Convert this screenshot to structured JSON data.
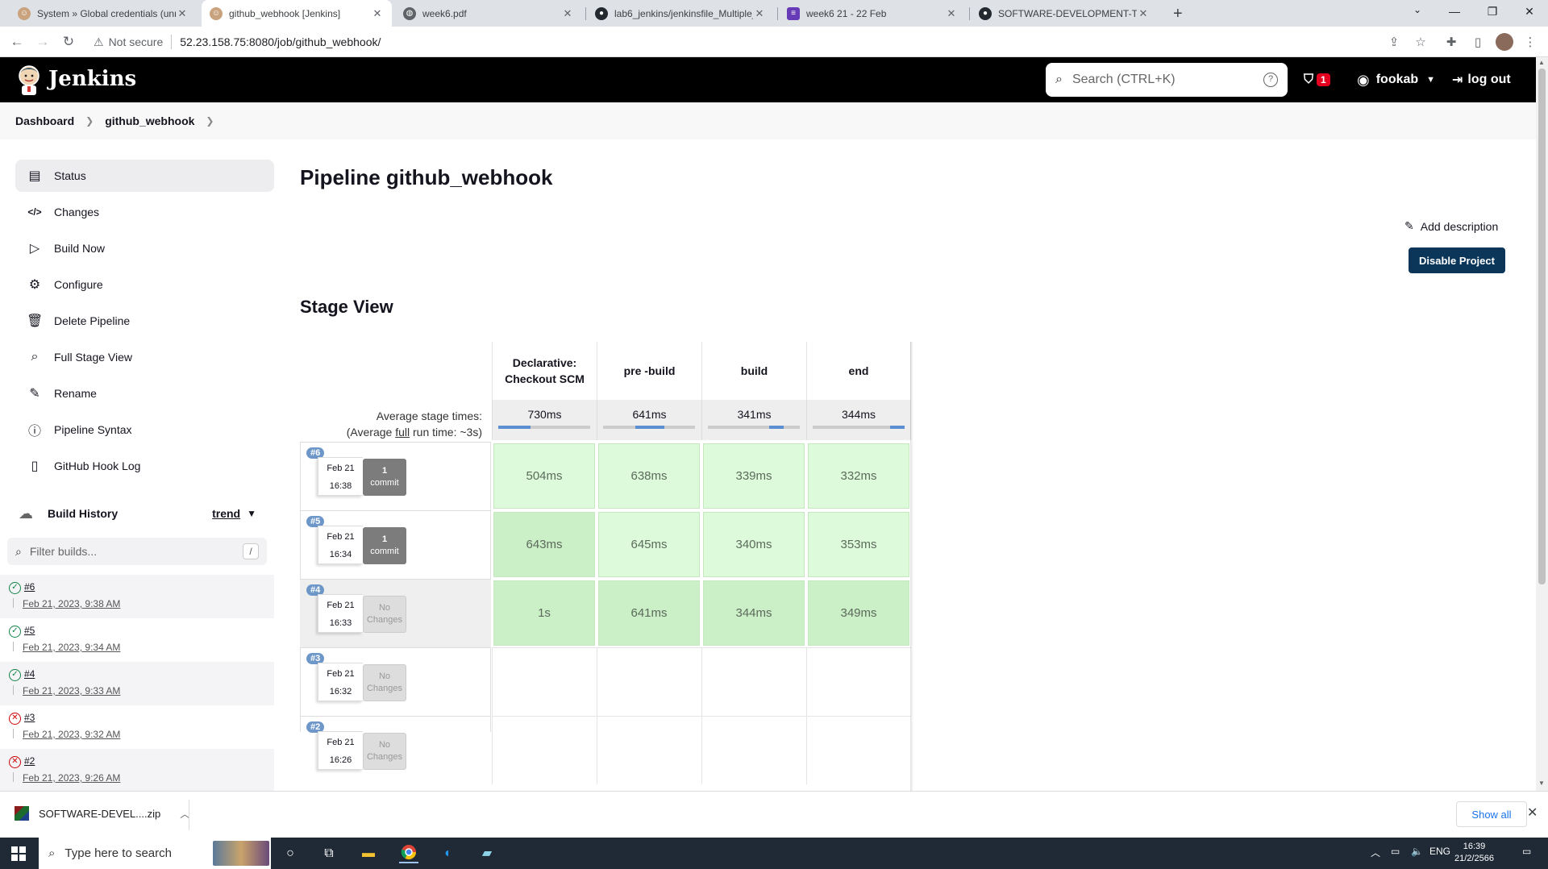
{
  "browser": {
    "tabs": [
      {
        "title": "System » Global credentials (unre",
        "icon": "jenkins-icon",
        "active": false
      },
      {
        "title": "github_webhook [Jenkins]",
        "icon": "jenkins-icon",
        "active": true
      },
      {
        "title": "week6.pdf",
        "icon": "globe-icon",
        "active": false
      },
      {
        "title": "lab6_jenkins/jenkinsfile_Multiple_",
        "icon": "github-icon",
        "active": false
      },
      {
        "title": "week6 21 - 22 Feb",
        "icon": "form-icon",
        "active": false
      },
      {
        "title": "SOFTWARE-DEVELOPMENT-TOO",
        "icon": "github-icon",
        "active": false
      }
    ],
    "security_label": "Not secure",
    "url": "52.23.158.75:8080/job/github_webhook/"
  },
  "header": {
    "brand": "Jenkins",
    "search_placeholder": "Search (CTRL+K)",
    "security_count": "1",
    "user": "fookab",
    "logout": "log out"
  },
  "breadcrumb": [
    "Dashboard",
    "github_webhook"
  ],
  "sidebar": {
    "items": [
      {
        "label": "Status",
        "icon": "notepad-icon",
        "glyph": "▤",
        "active": true
      },
      {
        "label": "Changes",
        "icon": "code-icon",
        "glyph": "</>",
        "active": false
      },
      {
        "label": "Build Now",
        "icon": "play-icon",
        "glyph": "▷",
        "active": false
      },
      {
        "label": "Configure",
        "icon": "gear-icon",
        "glyph": "⚙",
        "active": false
      },
      {
        "label": "Delete Pipeline",
        "icon": "trash-icon",
        "glyph": "🗑",
        "active": false
      },
      {
        "label": "Full Stage View",
        "icon": "search-icon",
        "glyph": "⌕",
        "active": false
      },
      {
        "label": "Rename",
        "icon": "pencil-icon",
        "glyph": "✎",
        "active": false
      },
      {
        "label": "Pipeline Syntax",
        "icon": "help-circle-icon",
        "glyph": "?",
        "active": false
      },
      {
        "label": "GitHub Hook Log",
        "icon": "clipboard-icon",
        "glyph": "📋",
        "active": false
      }
    ]
  },
  "build_history": {
    "title": "Build History",
    "trend": "trend",
    "filter_placeholder": "Filter builds...",
    "filter_shortcut": "/",
    "builds": [
      {
        "number": "#6",
        "date": "Feb 21, 2023, 9:38 AM",
        "status": "success"
      },
      {
        "number": "#5",
        "date": "Feb 21, 2023, 9:34 AM",
        "status": "success"
      },
      {
        "number": "#4",
        "date": "Feb 21, 2023, 9:33 AM",
        "status": "success"
      },
      {
        "number": "#3",
        "date": "Feb 21, 2023, 9:32 AM",
        "status": "failed"
      },
      {
        "number": "#2",
        "date": "Feb 21, 2023, 9:26 AM",
        "status": "failed"
      }
    ]
  },
  "main": {
    "title": "Pipeline github_webhook",
    "add_description": "Add description",
    "disable_button": "Disable Project",
    "stage_view_title": "Stage View"
  },
  "stage_view": {
    "stages": [
      "Declarative: Checkout SCM",
      "pre -build",
      "build",
      "end"
    ],
    "avg_label": "Average stage times:",
    "avg_run_prefix": "(Average ",
    "avg_run_link": "full",
    "avg_run_suffix": " run time: ~3s)",
    "avg_times": [
      "730ms",
      "641ms",
      "341ms",
      "344ms"
    ],
    "runs": [
      {
        "badge": "#6",
        "date": "Feb 21",
        "time": "16:38",
        "changes_top": "1",
        "changes_bottom": "commit",
        "kind": "commit",
        "times": [
          "504ms",
          "638ms",
          "339ms",
          "332ms"
        ]
      },
      {
        "badge": "#5",
        "date": "Feb 21",
        "time": "16:34",
        "changes_top": "1",
        "changes_bottom": "commit",
        "kind": "commit",
        "times": [
          "643ms",
          "645ms",
          "340ms",
          "353ms"
        ]
      },
      {
        "badge": "#4",
        "date": "Feb 21",
        "time": "16:33",
        "changes_top": "No",
        "changes_bottom": "Changes",
        "kind": "none",
        "times": [
          "1s",
          "641ms",
          "344ms",
          "349ms"
        ]
      },
      {
        "badge": "#3",
        "date": "Feb 21",
        "time": "16:32",
        "changes_top": "No",
        "changes_bottom": "Changes",
        "kind": "none",
        "times": []
      },
      {
        "badge": "#2",
        "date": "Feb 21",
        "time": "16:26",
        "changes_top": "No",
        "changes_bottom": "Changes",
        "kind": "none",
        "times": []
      }
    ]
  },
  "downloads": {
    "file": "SOFTWARE-DEVEL....zip",
    "show_all": "Show all"
  },
  "taskbar": {
    "search_placeholder": "Type here to search",
    "lang": "ENG",
    "time": "16:39",
    "date": "21/2/2566"
  }
}
